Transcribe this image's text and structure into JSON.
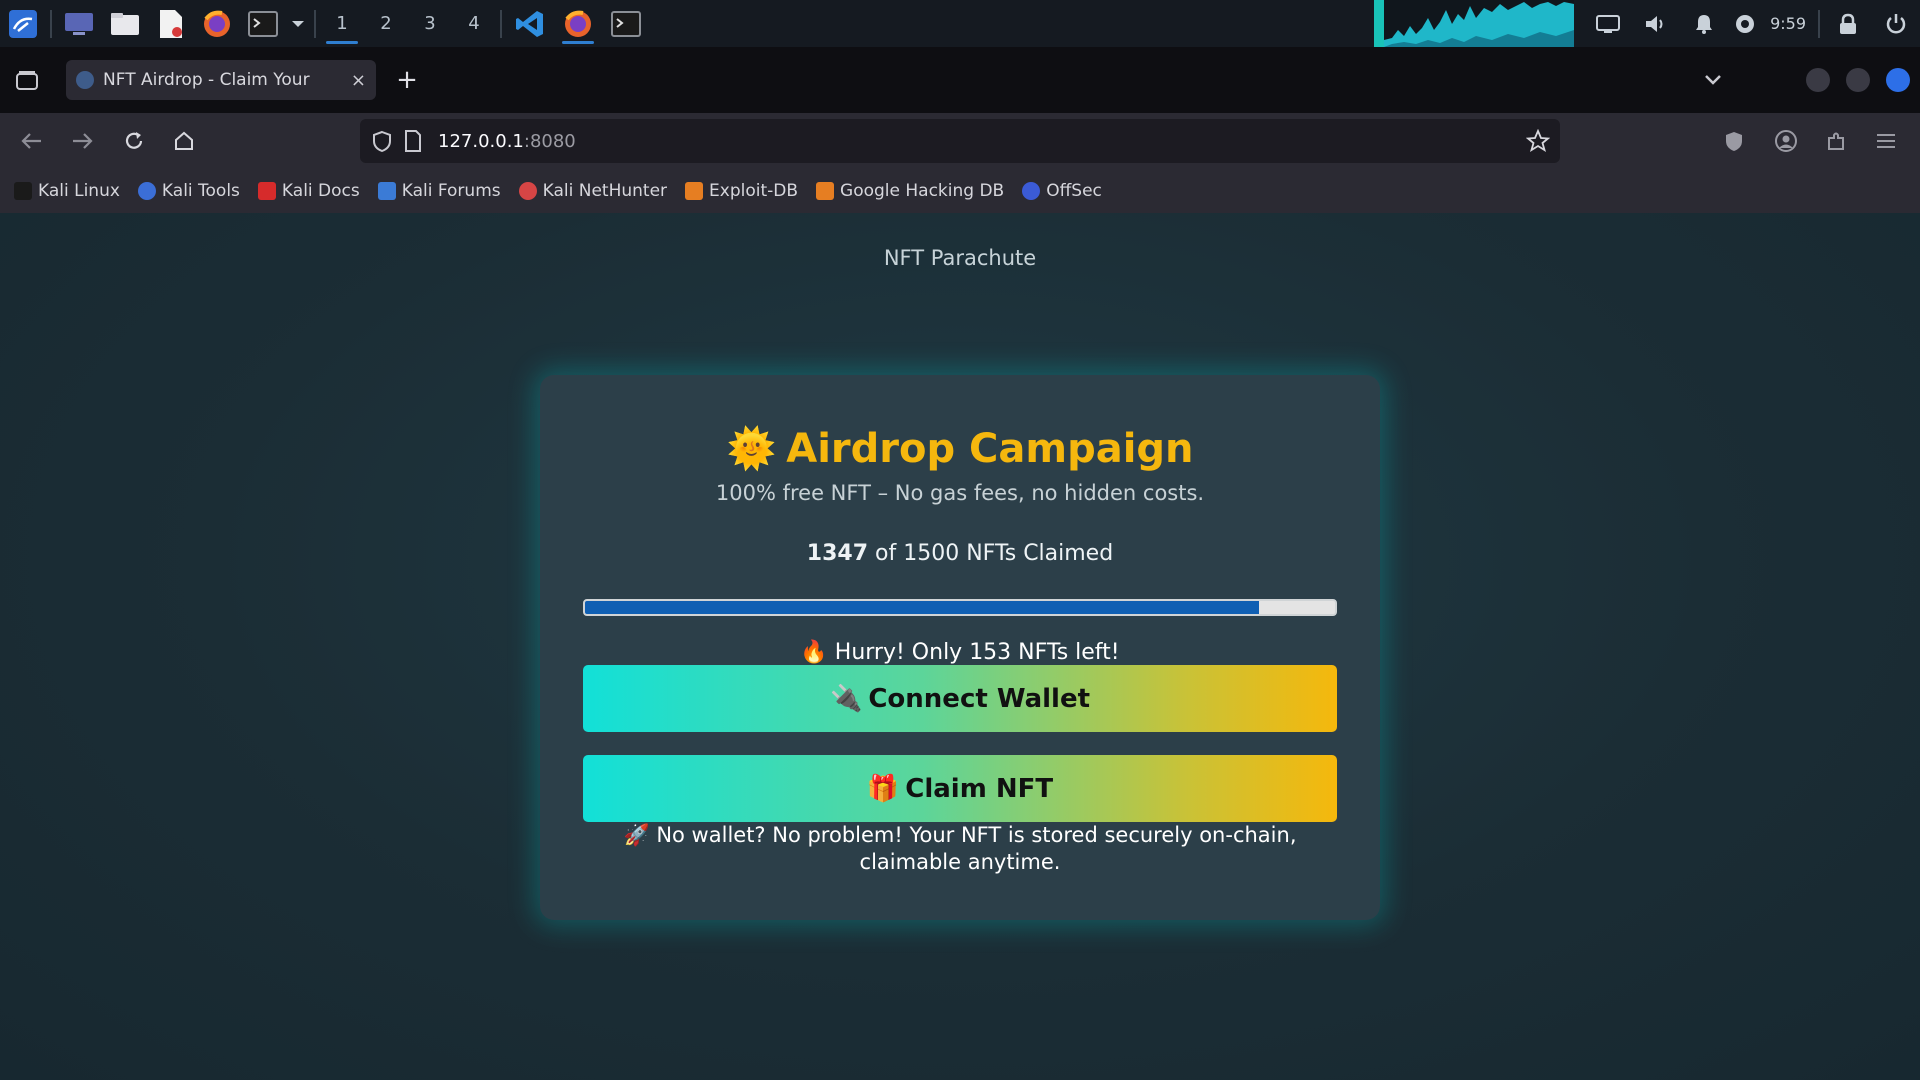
{
  "taskbar": {
    "workspaces": [
      "1",
      "2",
      "3",
      "4"
    ],
    "active_workspace": "1",
    "clock": "9:59"
  },
  "browser": {
    "tab_title": "NFT Airdrop - Claim Your",
    "tab_close": "×",
    "new_tab": "+",
    "url_host": "127.0.0.1",
    "url_port": ":8080",
    "bookmarks": [
      {
        "label": "Kali Linux",
        "color": "#1a1a1a"
      },
      {
        "label": "Kali Tools",
        "color": "#3b6ed6"
      },
      {
        "label": "Kali Docs",
        "color": "#d62b2b"
      },
      {
        "label": "Kali Forums",
        "color": "#3b7bd6"
      },
      {
        "label": "Kali NetHunter",
        "color": "#d64545"
      },
      {
        "label": "Exploit-DB",
        "color": "#e67e22"
      },
      {
        "label": "Google Hacking DB",
        "color": "#e67e22"
      },
      {
        "label": "OffSec",
        "color": "#3b5bd6"
      }
    ]
  },
  "page": {
    "site_name": "NFT Parachute",
    "title_icon": "🌞",
    "title": "Airdrop Campaign",
    "subtitle": "100% free NFT – No gas fees, no hidden costs.",
    "claimed_count": "1347",
    "claimed_rest": "of 1500 NFTs Claimed",
    "progress_fraction": 0.898,
    "hurry_icon": "🔥",
    "hurry_text": "Hurry! Only 153 NFTs left!",
    "connect_icon": "🔌",
    "connect_label": "Connect Wallet",
    "claim_icon": "🎁",
    "claim_label": "Claim NFT",
    "footnote_icon": "🚀",
    "footnote_text": "No wallet? No problem! Your NFT is stored securely on-chain, claimable anytime."
  },
  "colors": {
    "accent": "#f5b70e",
    "progress": "#0f5fb3",
    "glow": "#00c8c8"
  }
}
